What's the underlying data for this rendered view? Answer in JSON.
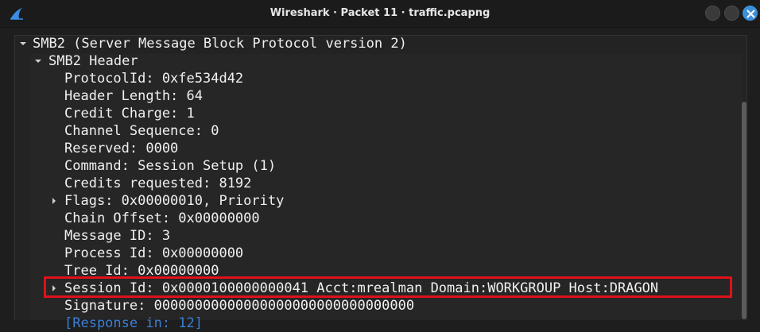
{
  "window": {
    "title": "Wireshark · Packet 11 · traffic.pcapng"
  },
  "tree": {
    "root_label": "SMB2 (Server Message Block Protocol version 2)",
    "header_label": "SMB2 Header",
    "fields": {
      "protocol_id": "ProtocolId: 0xfe534d42",
      "header_length": "Header Length: 64",
      "credit_charge": "Credit Charge: 1",
      "channel_sequence": "Channel Sequence: 0",
      "reserved": "Reserved: 0000",
      "command": "Command: Session Setup (1)",
      "credits_requested": "Credits requested: 8192",
      "flags": "Flags: 0x00000010, Priority",
      "chain_offset": "Chain Offset: 0x00000000",
      "message_id": "Message ID: 3",
      "process_id": "Process Id: 0x00000000",
      "tree_id": "Tree Id: 0x00000000",
      "session_id": "Session Id: 0x0000100000000041 Acct:mrealman Domain:WORKGROUP Host:DRAGON",
      "signature": "Signature: 00000000000000000000000000000000",
      "response_link": "[Response in: 12]"
    }
  },
  "colors": {
    "highlight_border": "#e0101a",
    "close_button": "#3d8fd8",
    "link_text": "#3b7fd6"
  },
  "icons": {
    "app": "wireshark-fin-icon",
    "close": "close-icon",
    "minimize": "minimize-icon",
    "maximize": "maximize-icon"
  }
}
